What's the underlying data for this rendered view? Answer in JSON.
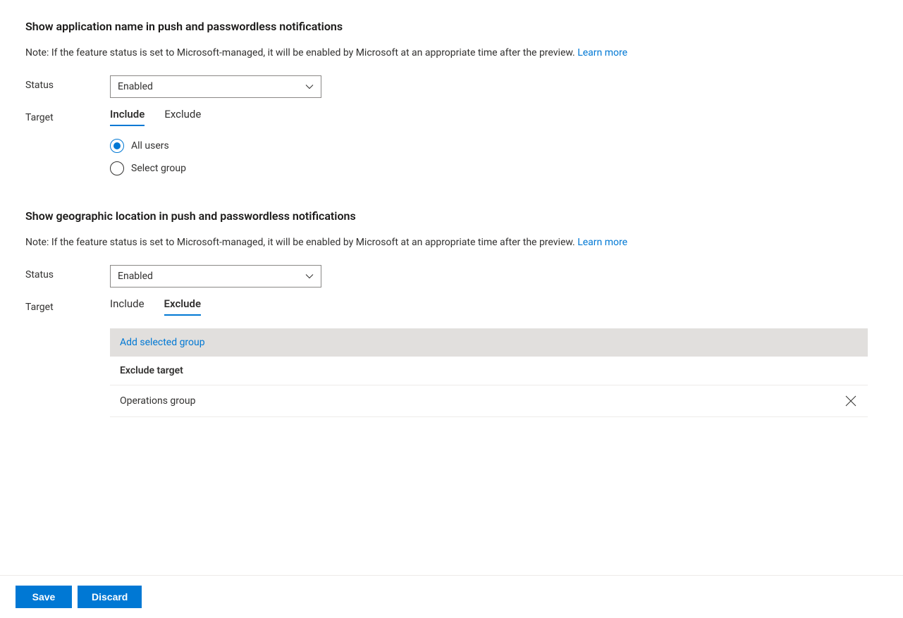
{
  "section1": {
    "title": "Show application name in push and passwordless notifications",
    "note_text": "Note: If the feature status is set to Microsoft-managed, it will be enabled by Microsoft at an appropriate time after the preview. ",
    "learn_more": "Learn more",
    "status_label": "Status",
    "status_value": "Enabled",
    "target_label": "Target",
    "tabs": {
      "include": "Include",
      "exclude": "Exclude"
    },
    "radios": {
      "all_users": "All users",
      "select_group": "Select group"
    }
  },
  "section2": {
    "title": "Show geographic location in push and passwordless notifications",
    "note_text": "Note: If the feature status is set to Microsoft-managed, it will be enabled by Microsoft at an appropriate time after the preview. ",
    "learn_more": "Learn more",
    "status_label": "Status",
    "status_value": "Enabled",
    "target_label": "Target",
    "tabs": {
      "include": "Include",
      "exclude": "Exclude"
    },
    "add_group": "Add selected group",
    "table_header": "Exclude target",
    "rows": [
      {
        "name": "Operations group"
      }
    ]
  },
  "footer": {
    "save": "Save",
    "discard": "Discard"
  }
}
